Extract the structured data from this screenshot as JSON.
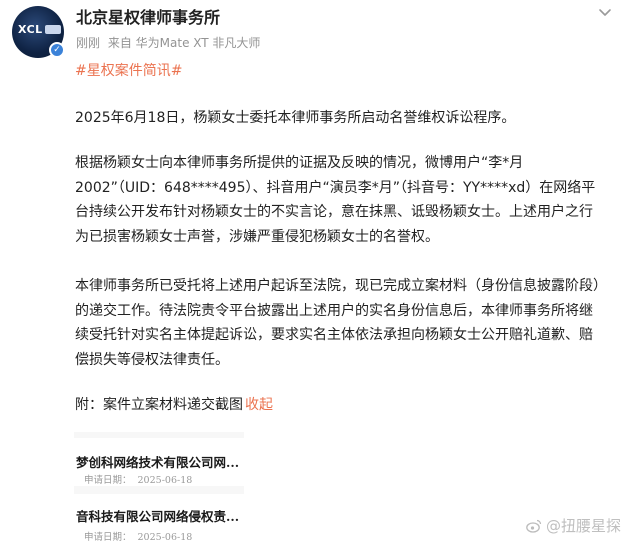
{
  "post": {
    "account_name": "北京星权律师事务所",
    "avatar_text": "XCL",
    "time": "刚刚",
    "source": "来自 华为Mate XT 非凡大师",
    "hashtag": "#星权案件简讯#",
    "paragraphs": [
      "2025年6月18日，杨颖女士委托本律师事务所启动名誉维权诉讼程序。",
      "根据杨颖女士向本律师事务所提供的证据及反映的情况，微博用户“李*月2002”（UID：648****495）、抖音用户“演员李*月”（抖音号：YY****xd）在网络平台持续公开发布针对杨颖女士的不实言论，意在抹黑、诋毁杨颖女士。上述用户之行为已损害杨颖女士声誉，涉嫌严重侵犯杨颖女士的名誉权。",
      "本律师事务所已受托将上述用户起诉至法院，现已完成立案材料（身份信息披露阶段）的递交工作。待法院责令平台披露出上述用户的实名身份信息后，本律师事务所将继续受托针对实名主体提起诉讼，要求实名主体依法承担向杨颖女士公开赔礼道歉、赔偿损失等侵权法律责任。"
    ],
    "attachment_label": "附：案件立案材料递交截图",
    "collapse_label": "收起"
  },
  "thumbnail": {
    "cards": [
      {
        "title": "梦创科网络技术有限公司网...",
        "date_label": "申请日期：",
        "date_value": "2025-06-18"
      },
      {
        "title": "音科技有限公司网络侵权责...",
        "date_label": "申请日期：",
        "date_value": "2025-06-18"
      }
    ]
  },
  "watermark": "@扭腰星探",
  "colors": {
    "accent": "#eb7350",
    "meta_gray": "#939393",
    "text": "#222222",
    "verified_blue": "#3b82d8"
  },
  "icons": {
    "menu": "chevron-down-icon",
    "verified": "verified-badge-icon",
    "watermark": "weibo-logo-icon"
  }
}
